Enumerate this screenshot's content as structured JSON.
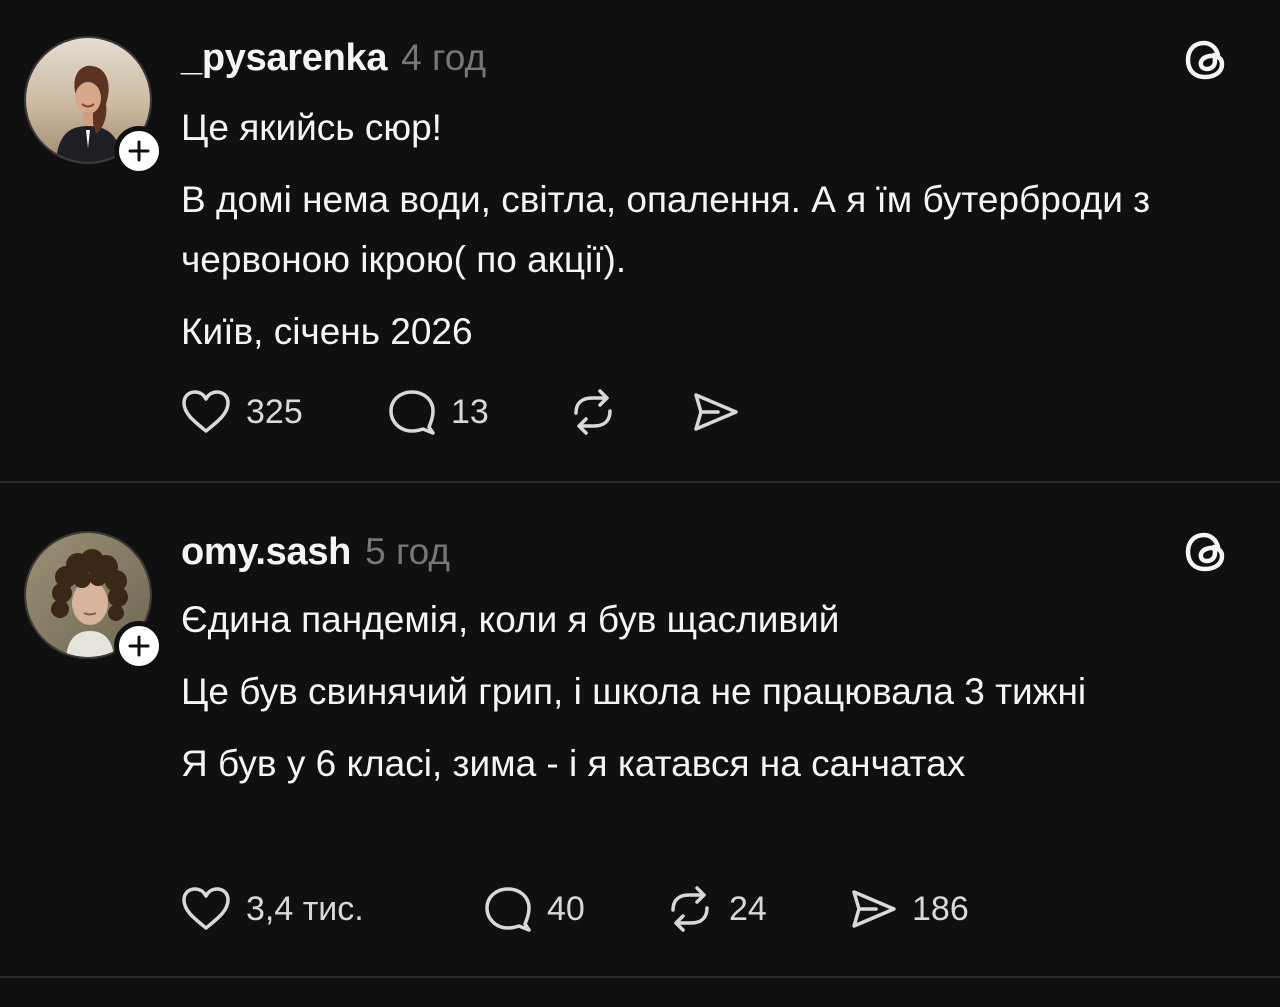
{
  "posts": [
    {
      "username": "_pysarenka",
      "time": "4 год",
      "avatar": "avatar-woman-smiling",
      "lines": [
        "Це якийсь сюр!",
        "В домі нема води, світла, опалення. А я  їм бутерброди з червоною ікрою( по акції).",
        "Київ, січень 2026"
      ],
      "actions": {
        "likes": "325",
        "replies": "13",
        "reposts": "",
        "shares": ""
      }
    },
    {
      "username": "omy.sash",
      "time": "5 год",
      "avatar": "avatar-curly-hair-man",
      "lines": [
        "Єдина пандемія, коли я був щасливий",
        "Це був свинячий грип, і школа не працювала 3 тижні",
        "Я був у 6 класі, зима - і я катався на санчатах"
      ],
      "actions": {
        "likes": "3,4 тис.",
        "replies": "40",
        "reposts": "24",
        "shares": "186"
      }
    }
  ],
  "icons": {
    "like": "heart-icon",
    "reply": "comment-icon",
    "repost": "repost-icon",
    "share": "send-icon",
    "threads": "threads-logo-icon",
    "follow": "plus-icon"
  },
  "colors": {
    "background": "#101010",
    "text": "#f3f5f7",
    "secondary": "#777777",
    "divider": "#2a2a2a"
  }
}
